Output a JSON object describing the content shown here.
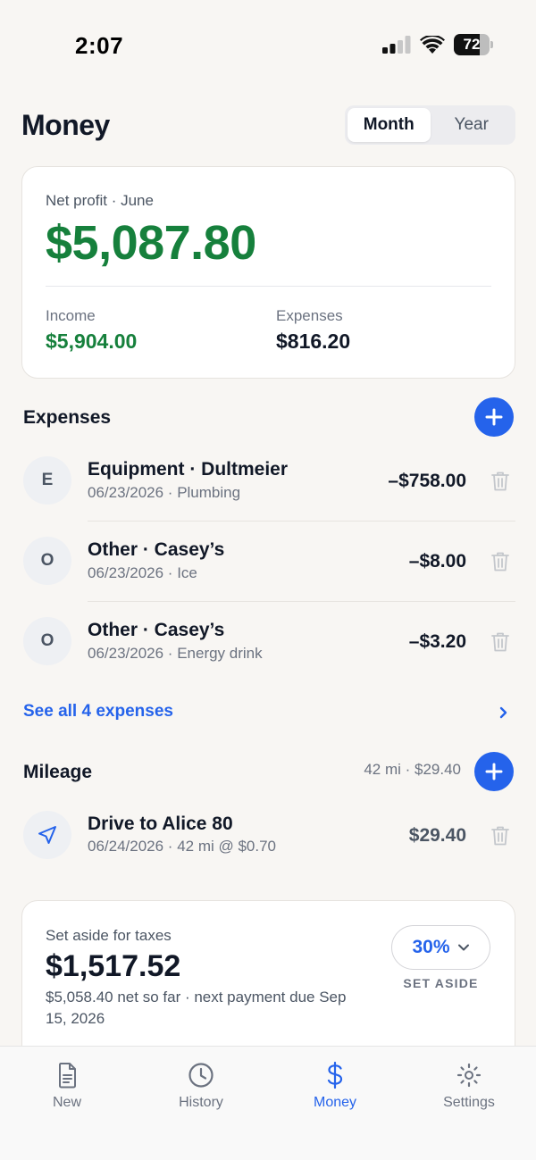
{
  "status_bar": {
    "time": "2:07",
    "battery": "72",
    "battery_level": 0.72
  },
  "header": {
    "title": "Money",
    "segments": [
      {
        "label": "Month",
        "active": true
      },
      {
        "label": "Year",
        "active": false
      }
    ]
  },
  "summary": {
    "label": "Net profit · June",
    "net_profit": "$5,087.80",
    "income_label": "Income",
    "income_value": "$5,904.00",
    "expenses_label": "Expenses",
    "expenses_value": "$816.20"
  },
  "expenses": {
    "title": "Expenses",
    "items": [
      {
        "initial": "E",
        "title": "Equipment · Dultmeier",
        "subtitle": "06/23/2026 · Plumbing",
        "amount": "–$758.00"
      },
      {
        "initial": "O",
        "title": "Other · Casey’s",
        "subtitle": "06/23/2026 · Ice",
        "amount": "–$8.00"
      },
      {
        "initial": "O",
        "title": "Other · Casey’s",
        "subtitle": "06/23/2026 · Energy drink",
        "amount": "–$3.20"
      }
    ],
    "see_all": "See all 4 expenses"
  },
  "mileage": {
    "title": "Mileage",
    "summary": "42 mi · $29.40",
    "items": [
      {
        "icon": "navigation-arrow-icon",
        "title": "Drive to Alice 80",
        "subtitle": "06/24/2026 · 42 mi @ $0.70",
        "amount": "$29.40"
      }
    ]
  },
  "taxes": {
    "label": "Set aside for taxes",
    "value": "$1,517.52",
    "note": "$5,058.40 net so far · next payment due Sep 15, 2026",
    "percent": "30%",
    "percent_caption": "SET ASIDE"
  },
  "tab_bar": {
    "tabs": [
      {
        "label": "New",
        "icon": "document-icon",
        "active": false
      },
      {
        "label": "History",
        "icon": "clock-icon",
        "active": false
      },
      {
        "label": "Money",
        "icon": "dollar-icon",
        "active": true
      },
      {
        "label": "Settings",
        "icon": "gear-icon",
        "active": false
      }
    ]
  },
  "colors": {
    "accent": "#2563eb",
    "positive": "#16803c",
    "background": "#f8f6f3"
  }
}
